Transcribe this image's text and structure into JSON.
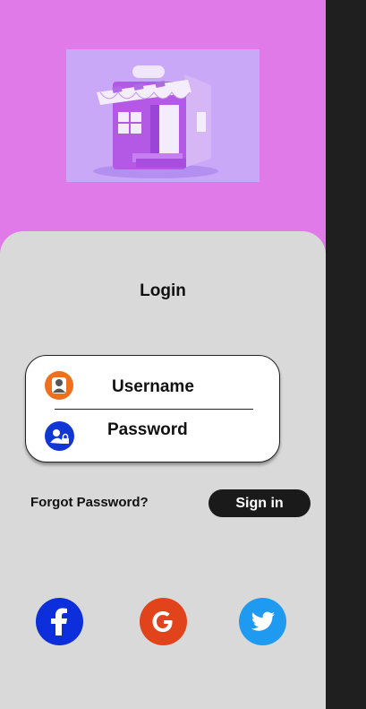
{
  "login": {
    "title": "Login",
    "username_label": "Username",
    "password_label": "Password",
    "forgot_label": "Forgot Password?",
    "signin_label": "Sign in"
  },
  "social": [
    {
      "name": "facebook",
      "icon": "facebook-icon",
      "color": "#0d2fdb"
    },
    {
      "name": "google",
      "icon": "google-icon",
      "color": "#e1441a"
    },
    {
      "name": "twitter",
      "icon": "twitter-icon",
      "color": "#1e9bf0"
    }
  ],
  "colors": {
    "header_bg": "#e07ae9",
    "card_bg": "#d9d9d9",
    "button_bg": "#1a1a1a",
    "user_avatar": "#ef6f1f",
    "lock_avatar": "#1036d6"
  }
}
